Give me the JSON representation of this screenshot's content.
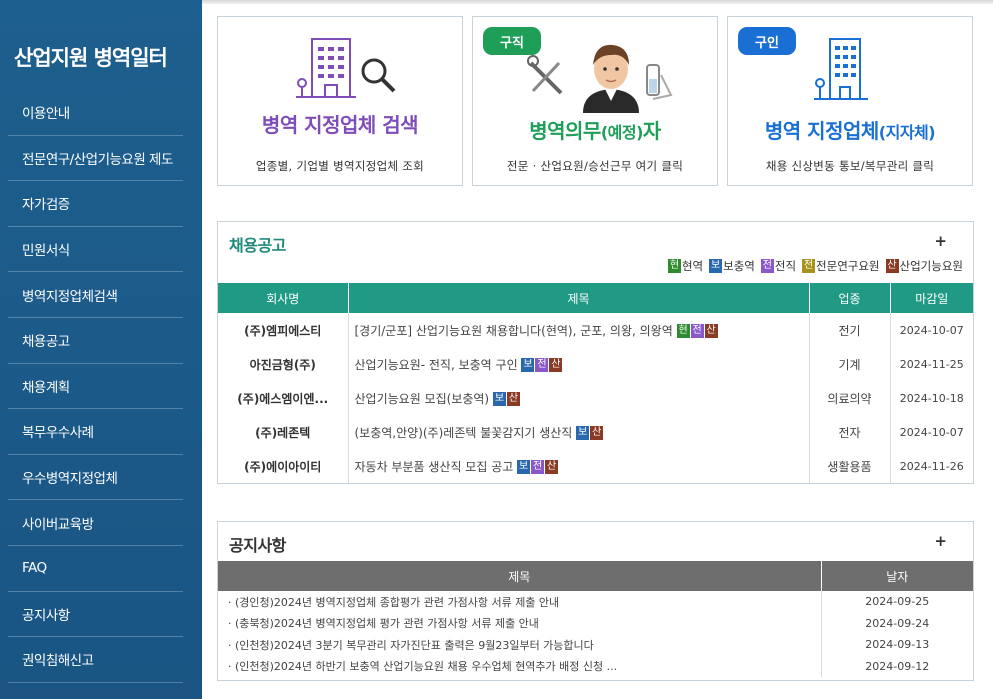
{
  "sidebar": {
    "title": "산업지원 병역일터",
    "items": [
      {
        "label": "이용안내"
      },
      {
        "label": "전문연구/산업기능요원 제도"
      },
      {
        "label": "자가검증"
      },
      {
        "label": "민원서식"
      },
      {
        "label": "병역지정업체검색"
      },
      {
        "label": "채용공고"
      },
      {
        "label": "채용계획"
      },
      {
        "label": "복무우수사례"
      },
      {
        "label": "우수병역지정업체"
      },
      {
        "label": "사이버교육방"
      },
      {
        "label": "FAQ"
      },
      {
        "label": "공지사항"
      },
      {
        "label": "권익침해신고"
      }
    ]
  },
  "cards": [
    {
      "title": "병역 지정업체 검색",
      "title_color": "#7e4db8",
      "desc": "업종별, 기업별 병역지정업체 조회",
      "icon": "building-search-icon"
    },
    {
      "badge": "구직",
      "badge_color": "#1f9e58",
      "title_main": "병역의무",
      "title_small": "(예정)",
      "title_end": "자",
      "title_color": "#1f9e58",
      "desc": "전문 · 산업요원/승선근무 여기 클릭",
      "icon": "person-tools-icon"
    },
    {
      "badge": "구인",
      "badge_color": "#1a6fd4",
      "title_main": "병역 지정업체",
      "title_small": "(지자체)",
      "title_color": "#1a6fd4",
      "desc": "채용 신상변동 통보/복무관리 클릭",
      "icon": "building-icon"
    }
  ],
  "recruit": {
    "title": "채용공고",
    "more": "+",
    "legend": [
      {
        "tag": "현",
        "label": "현역",
        "cls": "t-hyun"
      },
      {
        "tag": "보",
        "label": "보충역",
        "cls": "t-bo"
      },
      {
        "tag": "전",
        "label": "전직",
        "cls": "t-jeon"
      },
      {
        "tag": "전",
        "label": "전문연구요원",
        "cls": "t-jeonmun"
      },
      {
        "tag": "산",
        "label": "산업기능요원",
        "cls": "t-san"
      }
    ],
    "columns": [
      "회사명",
      "제목",
      "업종",
      "마감일"
    ],
    "rows": [
      {
        "company": "(주)엠피에스티",
        "title": "[경기/군포] 산업기능요원 채용합니다(현역), 군포, 의왕, 의왕역",
        "tags": [
          [
            "현",
            "t-hyun"
          ],
          [
            "전",
            "t-jeon"
          ],
          [
            "산",
            "t-san"
          ]
        ],
        "sector": "전기",
        "deadline": "2024-10-07"
      },
      {
        "company": "아진금형(주)",
        "title": "산업기능요원- 전직, 보충역 구인",
        "tags": [
          [
            "보",
            "t-bo"
          ],
          [
            "전",
            "t-jeon"
          ],
          [
            "산",
            "t-san"
          ]
        ],
        "sector": "기계",
        "deadline": "2024-11-25"
      },
      {
        "company": "(주)에스엠이엔...",
        "title": "산업기능요원 모집(보충역)",
        "tags": [
          [
            "보",
            "t-bo"
          ],
          [
            "산",
            "t-san"
          ]
        ],
        "sector": "의료의약",
        "deadline": "2024-10-18"
      },
      {
        "company": "(주)레존텍",
        "title": "(보충역,안양)(주)레존텍 불꽃감지기 생산직",
        "tags": [
          [
            "보",
            "t-bo"
          ],
          [
            "산",
            "t-san"
          ]
        ],
        "sector": "전자",
        "deadline": "2024-10-07"
      },
      {
        "company": "(주)에이아이티",
        "title": "자동차 부분품 생산직 모집 공고",
        "tags": [
          [
            "보",
            "t-bo"
          ],
          [
            "전",
            "t-jeon"
          ],
          [
            "산",
            "t-san"
          ]
        ],
        "sector": "생활용품",
        "deadline": "2024-11-26"
      }
    ]
  },
  "notice": {
    "title": "공지사항",
    "more": "+",
    "columns": [
      "제목",
      "날자"
    ],
    "rows": [
      {
        "title": "· (경인청)2024년 병역지정업체 종합평가 관련 가점사항 서류 제출 안내",
        "date": "2024-09-25"
      },
      {
        "title": "· (충북청)2024년 병역지정업체 평가 관련 가점사항 서류 제출 안내",
        "date": "2024-09-24"
      },
      {
        "title": "· (인천청)2024년 3분기 복무관리 자가진단표 출력은 9월23일부터 가능합니다",
        "date": "2024-09-13"
      },
      {
        "title": "· (인천청)2024년 하반기 보충역 산업기능요원 채용 우수업체 현역추가 배정 신청 ...",
        "date": "2024-09-12"
      }
    ]
  }
}
